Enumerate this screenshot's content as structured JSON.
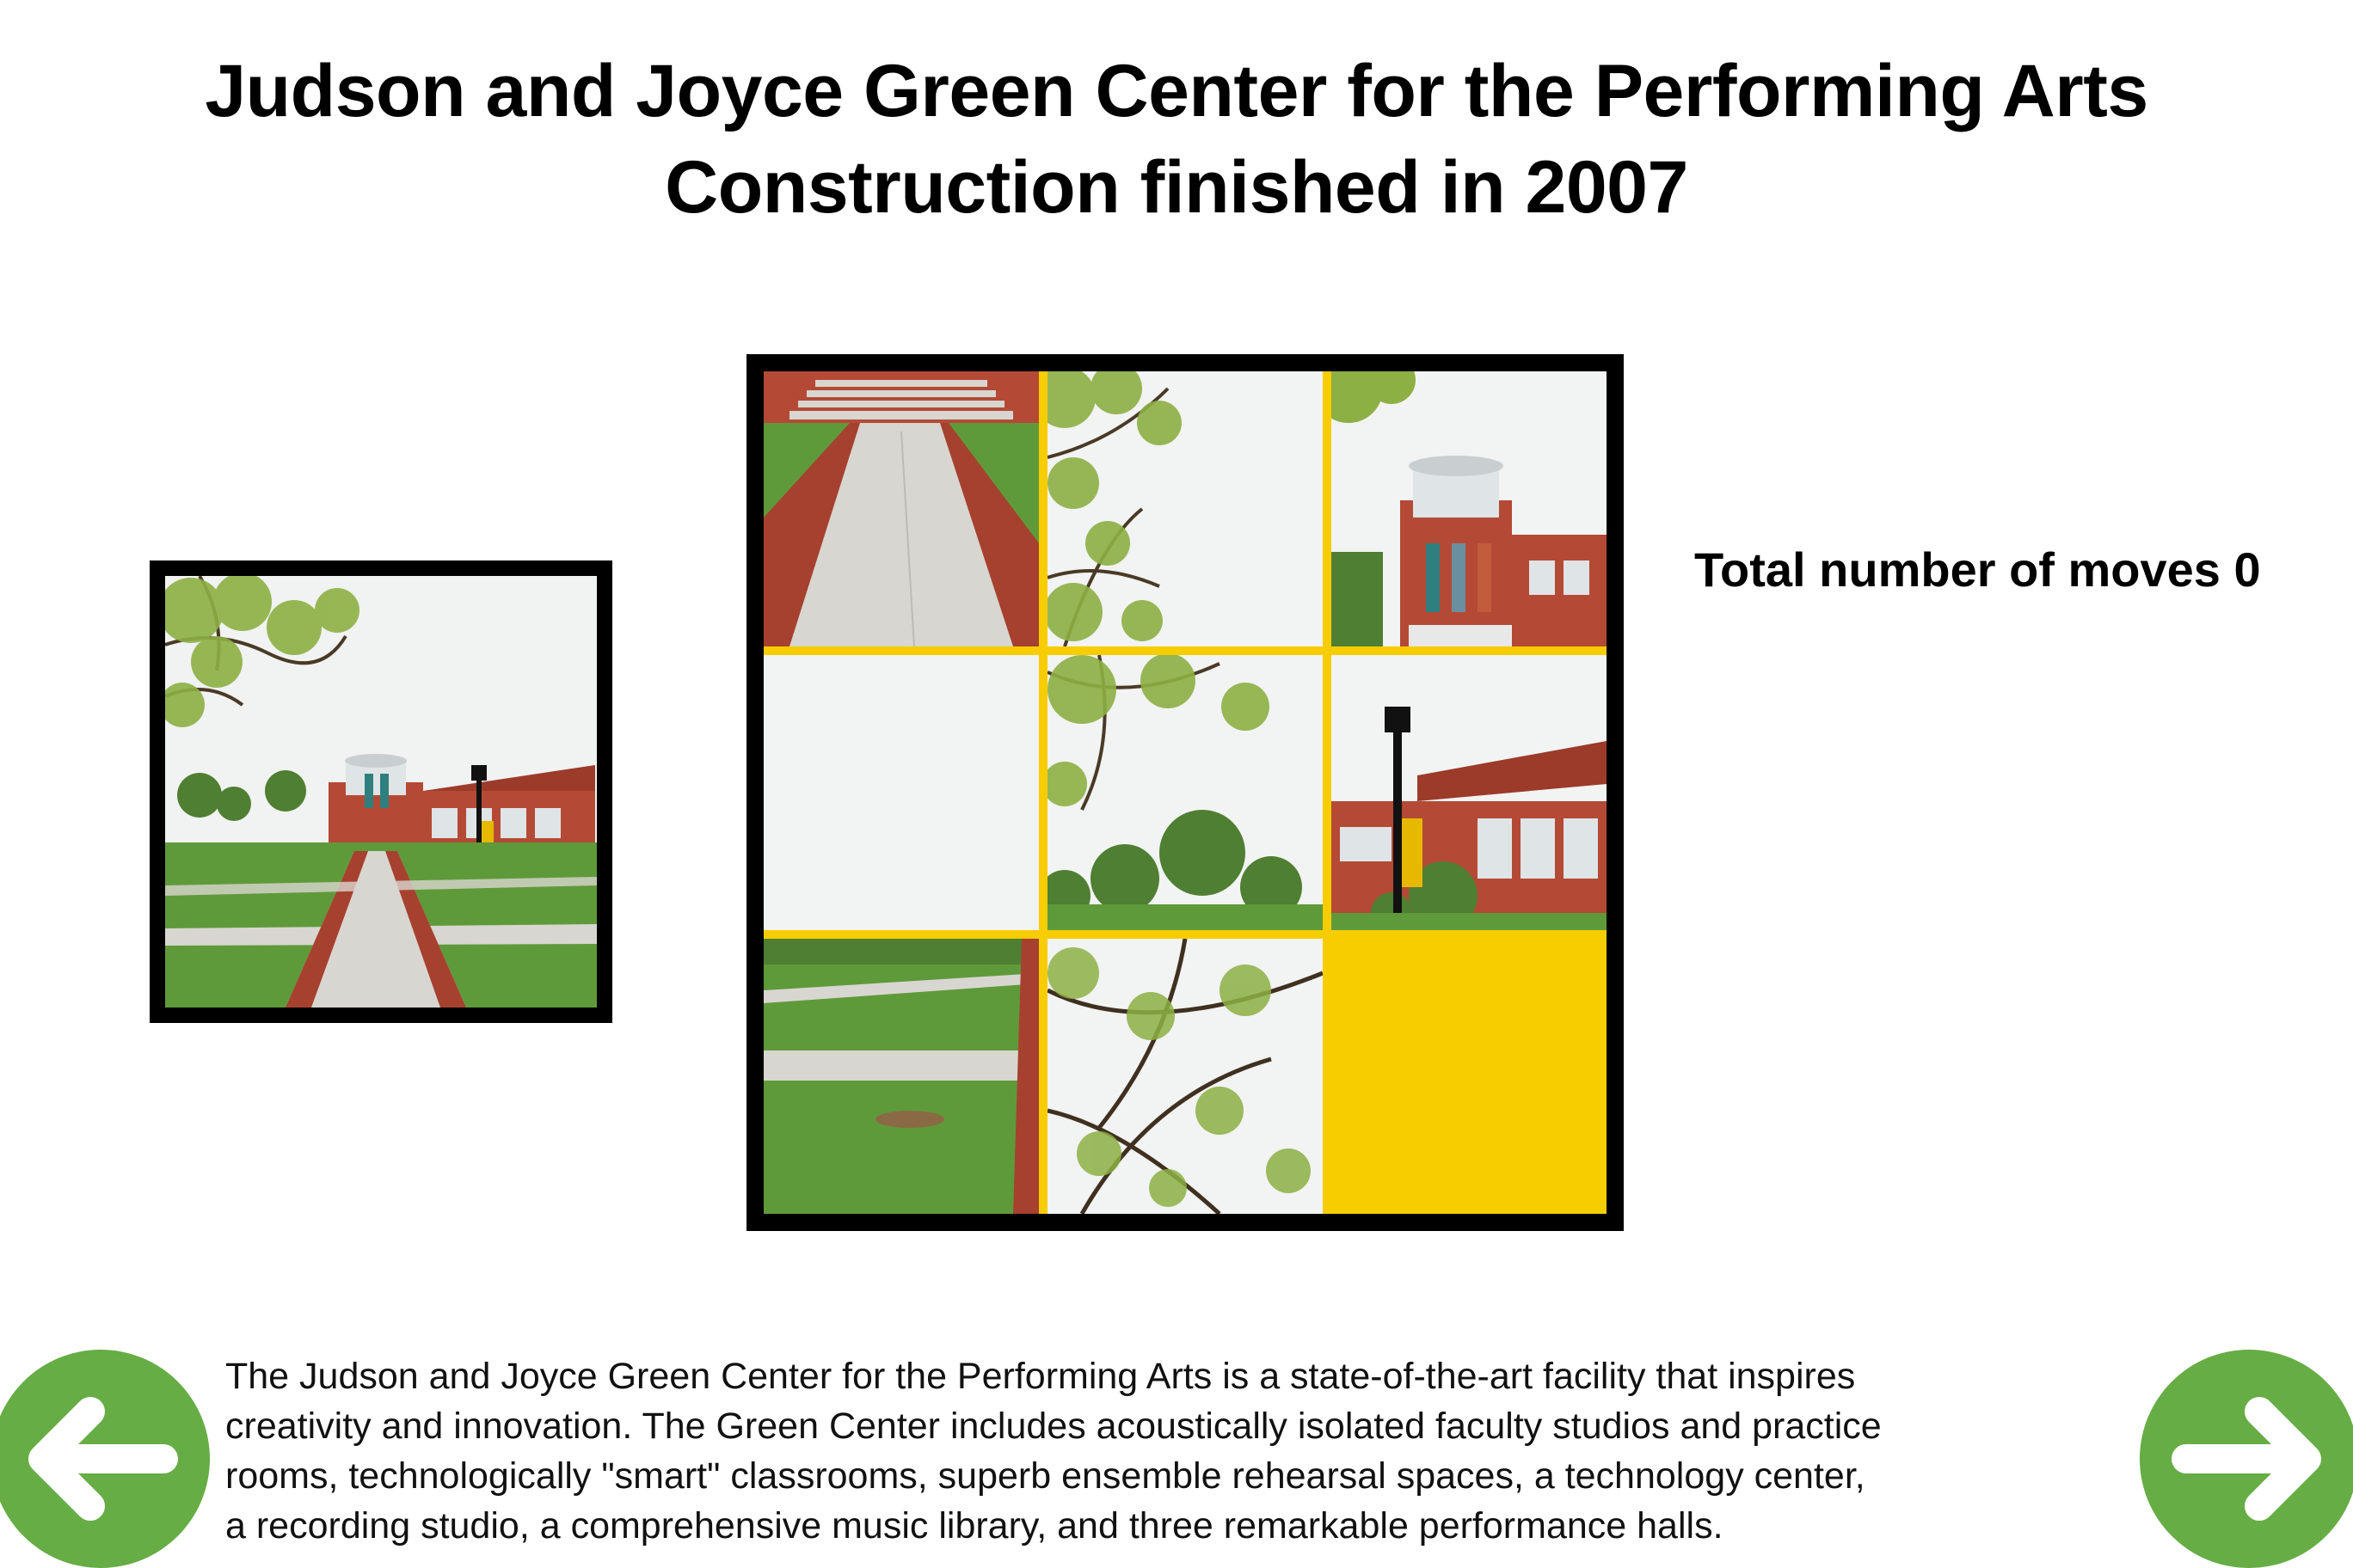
{
  "header": {
    "title_line1": "Judson and Joyce Green Center for the Performing Arts",
    "title_line2": "Construction finished in 2007"
  },
  "reference_image": {
    "icon": "campus-building-photo-thumbnail"
  },
  "puzzle": {
    "grid": "3x3",
    "tiles": [
      {
        "icon": "walkway-steps-photo-piece"
      },
      {
        "icon": "tree-branches-sky-photo-piece"
      },
      {
        "icon": "building-rotunda-photo-piece"
      },
      {
        "icon": "sky-photo-piece"
      },
      {
        "icon": "trees-lawn-photo-piece"
      },
      {
        "icon": "lamppost-building-photo-piece"
      },
      {
        "icon": "lawn-path-photo-piece"
      },
      {
        "icon": "branches-photo-piece"
      },
      {
        "icon": "empty-slot"
      }
    ],
    "empty_color": "#f7cd00"
  },
  "status": {
    "moves_text": "Total number of moves 0"
  },
  "description": {
    "line1": "The Judson and Joyce Green Center for the Performing Arts is a state-of-the-art facility that inspires",
    "line2": "creativity and innovation. The Green Center includes acoustically isolated faculty studios and practice",
    "line3": "rooms, technologically \"smart\" classrooms, superb ensemble rehearsal spaces, a technology center,",
    "line4": "a recording studio, a comprehensive music library, and three remarkable performance halls."
  },
  "navigation": {
    "prev_icon": "arrow-left-icon",
    "next_icon": "arrow-right-icon",
    "button_color": "#66ad45"
  },
  "colors": {
    "board_frame": "#000000",
    "tile_gap": "#f7cd00",
    "grass": "#5f9a3a",
    "brick": "#a6412f",
    "path": "#d8d6d0",
    "sky": "#f2f3f3"
  }
}
